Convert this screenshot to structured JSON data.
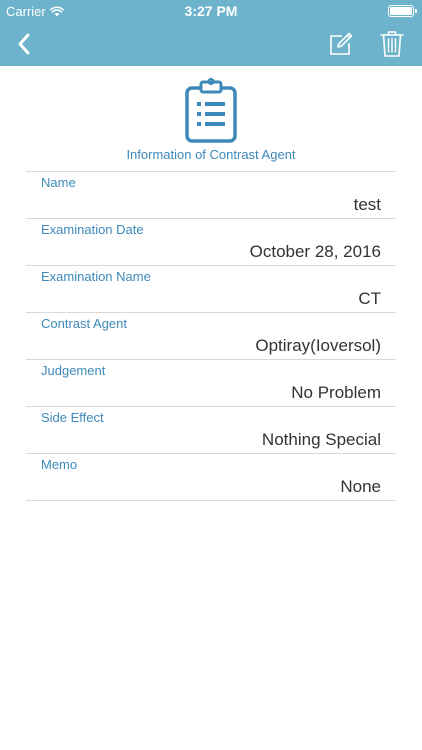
{
  "status_bar": {
    "carrier": "Carrier",
    "time": "3:27 PM"
  },
  "nav": {
    "back_icon": "chevron-left-icon",
    "edit_icon": "edit-icon",
    "trash_icon": "trash-icon"
  },
  "hero": {
    "icon": "clipboard-list-icon",
    "title": "Information of Contrast Agent"
  },
  "fields": [
    {
      "label": "Name",
      "value": "test"
    },
    {
      "label": "Examination Date",
      "value": "October 28, 2016"
    },
    {
      "label": "Examination Name",
      "value": "CT"
    },
    {
      "label": "Contrast Agent",
      "value": "Optiray(Ioversol)"
    },
    {
      "label": "Judgement",
      "value": "No Problem"
    },
    {
      "label": "Side Effect",
      "value": "Nothing Special"
    },
    {
      "label": "Memo",
      "value": "None"
    }
  ],
  "colors": {
    "header": "#6db3cc",
    "accent": "#3d89ba",
    "value_text": "#333333",
    "divider": "#d9d9d9"
  }
}
